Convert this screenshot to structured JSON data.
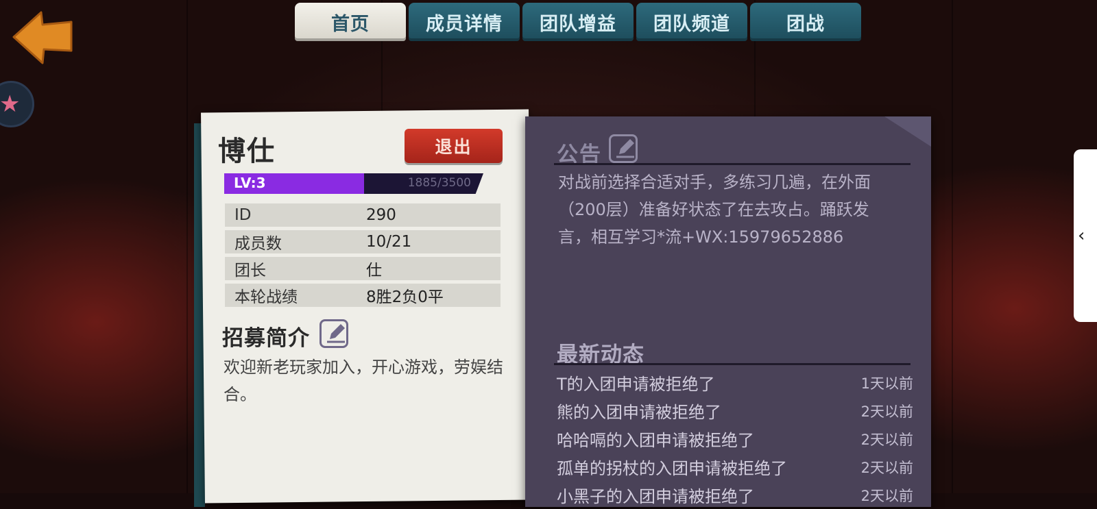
{
  "tabs": [
    "首页",
    "成员详情",
    "团队增益",
    "团队频道",
    "团战"
  ],
  "active_tab": 0,
  "guild": {
    "name": "博仕",
    "exit_label": "退出",
    "level_label": "LV:3",
    "xp_text": "1885/3500",
    "xp_fraction": 0.539
  },
  "info_rows": [
    {
      "key": "ID",
      "value": "290"
    },
    {
      "key": "成员数",
      "value": "10/21"
    },
    {
      "key": "团长",
      "value": "仕"
    },
    {
      "key": "本轮战绩",
      "value": "8胜2负0平"
    }
  ],
  "recruit": {
    "title": "招募简介",
    "text": "欢迎新老玩家加入，开心游戏，劳娱结合。"
  },
  "notice": {
    "title": "公告",
    "text": "对战前选择合适对手，多练习几遍，在外面（200层）准备好状态了在去攻占。踊跃发言，相互学习*流+WX:15979652886"
  },
  "news": {
    "title": "最新动态",
    "items": [
      {
        "text": "T的入团申请被拒绝了",
        "time": "1天以前"
      },
      {
        "text": "熊的入团申请被拒绝了",
        "time": "2天以前"
      },
      {
        "text": "哈哈嗝的入团申请被拒绝了",
        "time": "2天以前"
      },
      {
        "text": "孤单的拐杖的入团申请被拒绝了",
        "time": "2天以前"
      },
      {
        "text": "小黑子的入团申请被拒绝了",
        "time": "2天以前"
      }
    ]
  },
  "side_handle_glyph": "‹",
  "colors": {
    "tab_active": "#e9e7df",
    "tab_inactive": "#26596a",
    "exit_button": "#c22f22",
    "xp_fill": "#8a2be2",
    "board": "#4a4258",
    "paper": "#efeee8"
  },
  "icons": [
    "back-arrow-icon",
    "star-avatar-icon",
    "edit-icon",
    "chevron-left-icon"
  ]
}
